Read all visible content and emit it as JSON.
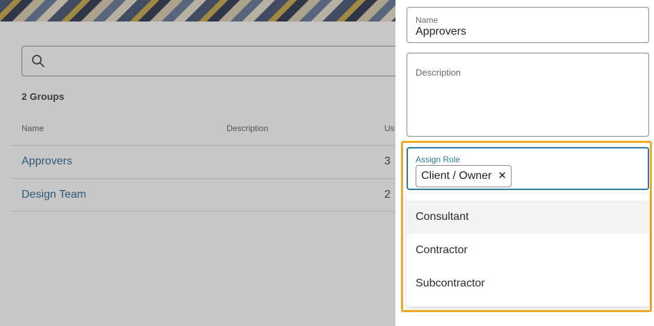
{
  "list": {
    "group_count": "2 Groups",
    "columns": {
      "name": "Name",
      "description": "Description",
      "users": "Us"
    },
    "rows": [
      {
        "name": "Approvers",
        "users": "3"
      },
      {
        "name": "Design Team",
        "users": "2"
      }
    ]
  },
  "drawer": {
    "name": {
      "label": "Name",
      "value": "Approvers"
    },
    "description": {
      "label": "Description",
      "value": ""
    },
    "assign_role": {
      "label": "Assign Role",
      "selected_chip": "Client / Owner",
      "chip_remove": "✕",
      "options": [
        "Consultant",
        "Contractor",
        "Subcontractor"
      ]
    }
  },
  "colors": {
    "link": "#1c5a8a",
    "focus": "#2a7aa6",
    "highlight": "#f0a922"
  }
}
